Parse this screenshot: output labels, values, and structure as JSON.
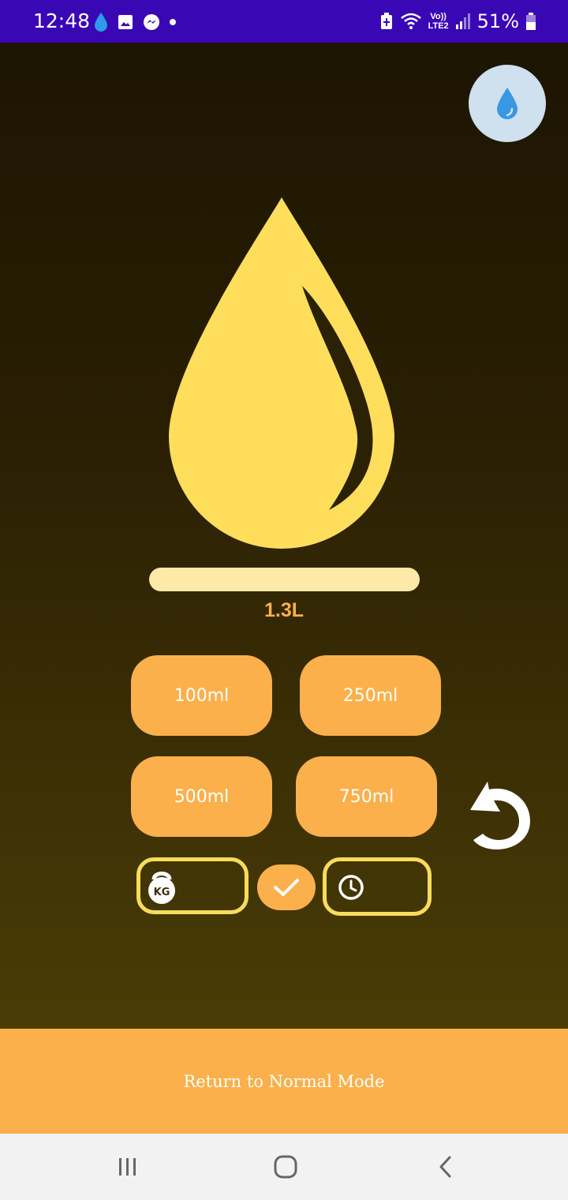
{
  "status_bar": {
    "time": "12:48",
    "battery_percent": "51%",
    "network": "LTE2",
    "volte": "Vo))"
  },
  "colors": {
    "accent": "#fbb04b",
    "drop": "#ffde5c",
    "status_bar": "#3a07b5"
  },
  "intake": {
    "amount": "1.3L",
    "progress_fraction": 1.0
  },
  "quick_add": {
    "b100": "100ml",
    "b250": "250ml",
    "b500": "500ml",
    "b750": "750ml"
  },
  "fields": {
    "weight_icon_text": "KG",
    "weight_value": "",
    "time_value": ""
  },
  "footer": {
    "return_label": "Return to Normal Mode"
  },
  "icons": [
    "water-drop-icon",
    "undo-icon",
    "kettlebell-icon",
    "checkmark-icon",
    "clock-icon",
    "recents-icon",
    "home-icon",
    "back-icon"
  ]
}
